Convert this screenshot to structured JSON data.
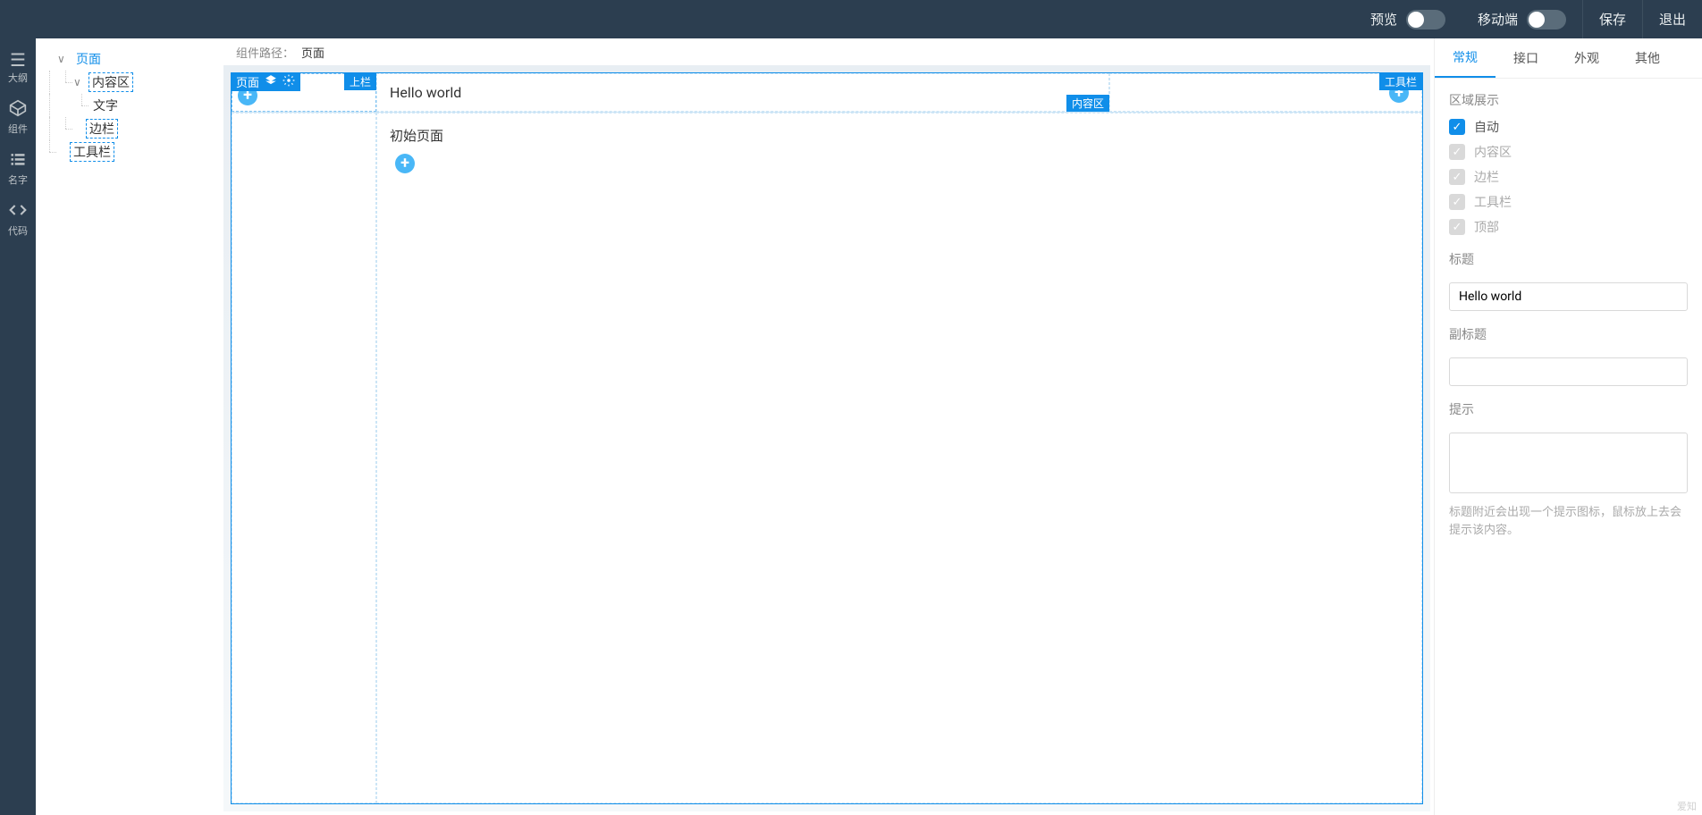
{
  "topbar": {
    "preview": "预览",
    "mobile": "移动端",
    "save": "保存",
    "exit": "退出"
  },
  "leftbar": {
    "outline": "大纲",
    "components": "组件",
    "names": "名字",
    "code": "代码"
  },
  "outline": {
    "page": "页面",
    "contentArea": "内容区",
    "text": "文字",
    "sidebar": "边栏",
    "toolbar": "工具栏"
  },
  "breadcrumb": {
    "label": "组件路径：",
    "path": "页面"
  },
  "canvas": {
    "pageLabel": "页面",
    "sidebarLabel": "上栏",
    "contentLabel": "内容区",
    "toolbarLabel": "工具栏",
    "title": "Hello world",
    "initialPage": "初始页面"
  },
  "props": {
    "tabs": {
      "general": "常规",
      "interface": "接口",
      "appearance": "外观",
      "other": "其他"
    },
    "regionDisplay": {
      "title": "区域展示",
      "auto": "自动",
      "contentArea": "内容区",
      "sidebar": "边栏",
      "toolbar": "工具栏",
      "top": "顶部"
    },
    "titleField": {
      "label": "标题",
      "value": "Hello world"
    },
    "subtitleField": {
      "label": "副标题",
      "value": ""
    },
    "hintField": {
      "label": "提示",
      "value": "",
      "help": "标题附近会出现一个提示图标，鼠标放上去会提示该内容。"
    }
  },
  "watermark": "爱知"
}
